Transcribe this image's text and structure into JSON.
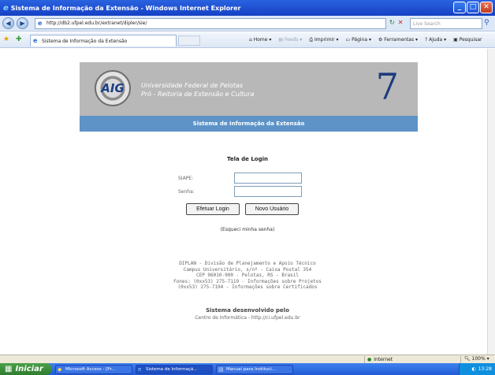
{
  "window": {
    "title": "Sistema de Informação da Extensão - Windows Internet Explorer",
    "buttons": {
      "minimize": "_",
      "maximize": "□",
      "close": "✕"
    }
  },
  "addressbar": {
    "url": "http://db2.ufpel.edu.br/extranet/dipler/sie/",
    "search_placeholder": "Live Search"
  },
  "tab": {
    "label": "Sistema de Informação da Extensão"
  },
  "commands": {
    "home": "Home",
    "feeds": "Feeds",
    "print": "Imprimir",
    "page": "Página",
    "tools": "Ferramentas",
    "help": "Ajuda",
    "research": "Pesquisar"
  },
  "banner": {
    "logo_text": "AIG",
    "university_line1": "Universidade Federal de Pelotas",
    "university_line2": "Pró - Reitoria de Extensão e Cultura",
    "logo_right": "7",
    "system_title": "Sistema de Informação da Extensão"
  },
  "login": {
    "title": "Tela de Login",
    "siape_label": "SIAPE:",
    "siape_value": "",
    "senha_label": "Senha:",
    "senha_value": "",
    "submit_button": "Efetuar Login",
    "new_user_button": "Novo Usuário",
    "forgot_link": "(Esqueci minha senha)"
  },
  "footer": {
    "line1": "DIPLAN - Divisão de Planejamento e Apoio Técnico",
    "line2": "Campus Universitário, s/nº - Caixa Postal 354",
    "line3": "CEP 96010-900 - Pelotas, RS - Brasil",
    "line4": "Fones: (0xx53) 275-7119 - Informações sobre Projetos",
    "line5": "(0xx53) 275-7194 - Informações sobre Certificados",
    "credit_title": "Sistema desenvolvido pelo",
    "credit_sub": "Centro de Informática - http://ci.ufpel.edu.br"
  },
  "statusbar": {
    "zone": "Internet",
    "zoom": "100%"
  },
  "taskbar": {
    "start": "Iniciar",
    "tasks": [
      "Microsoft Access - [Pr...",
      "Sistema de Informaçã...",
      "Manual para Instituci..."
    ],
    "clock": "13:28"
  }
}
